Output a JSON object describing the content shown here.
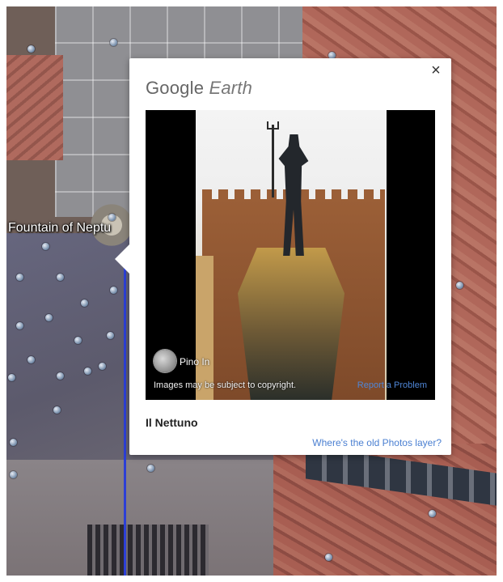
{
  "map": {
    "place_label": "Fountain of Neptu"
  },
  "popup": {
    "brand_google": "Google",
    "brand_earth": "Earth",
    "close_glyph": "×",
    "photo": {
      "author": "Pino In",
      "copyright": "Images may be subject to copyright.",
      "report_link": "Report a Problem"
    },
    "title": "Il Nettuno",
    "old_photos_link": "Where's the old Photos layer?"
  },
  "colors": {
    "link": "#4a7fd1",
    "path_line": "#2c3fd6"
  }
}
